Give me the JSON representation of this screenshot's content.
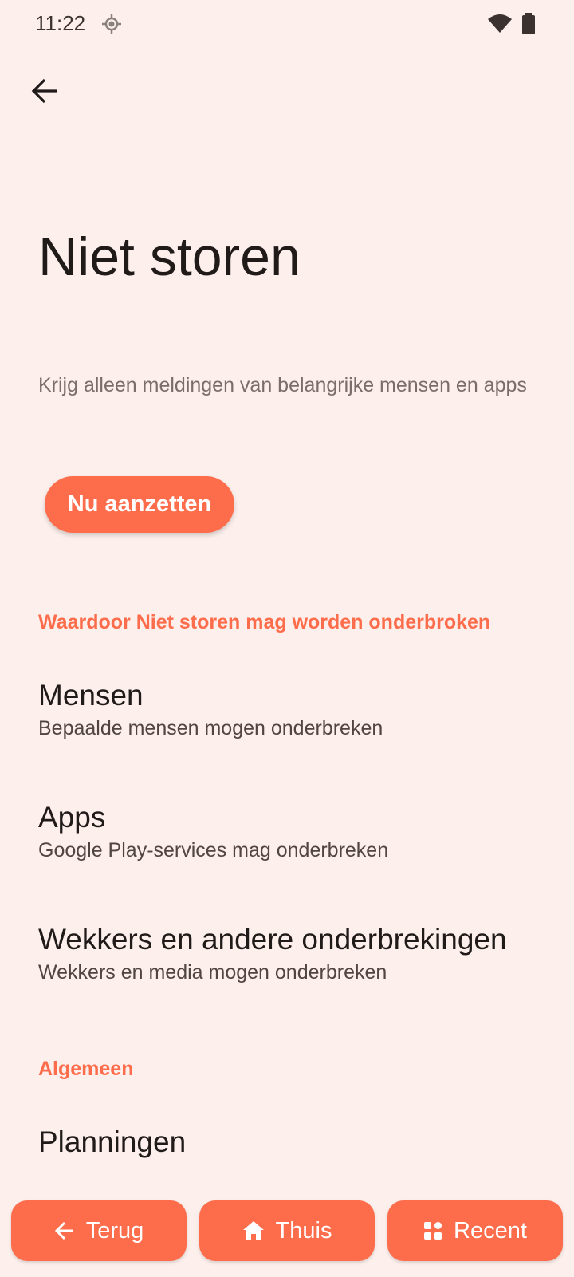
{
  "status_bar": {
    "time": "11:22",
    "icons": [
      "location-icon",
      "wifi-icon",
      "battery-icon"
    ]
  },
  "header": {
    "back_icon": "arrow-back-icon",
    "title": "Niet storen"
  },
  "main": {
    "description": "Krijg alleen meldingen van belangrijke mensen en apps",
    "primary_button_label": "Nu aanzetten",
    "section_interruptions": {
      "header": "Waardoor Niet storen mag worden onderbroken",
      "items": [
        {
          "title": "Mensen",
          "subtitle": "Bepaalde mensen mogen onderbreken"
        },
        {
          "title": "Apps",
          "subtitle": "Google Play-services mag onderbreken"
        },
        {
          "title": "Wekkers en andere onderbrekingen",
          "subtitle": "Wekkers en media mogen onderbreken"
        }
      ]
    },
    "section_general": {
      "header": "Algemeen",
      "items": [
        {
          "title": "Planningen"
        }
      ]
    }
  },
  "bottom_nav": {
    "back_label": "Terug",
    "home_label": "Thuis",
    "recent_label": "Recent"
  },
  "colors": {
    "background": "#fcefec",
    "accent": "#fe6d4b",
    "text_primary": "#201a19",
    "text_secondary": "#504542"
  }
}
